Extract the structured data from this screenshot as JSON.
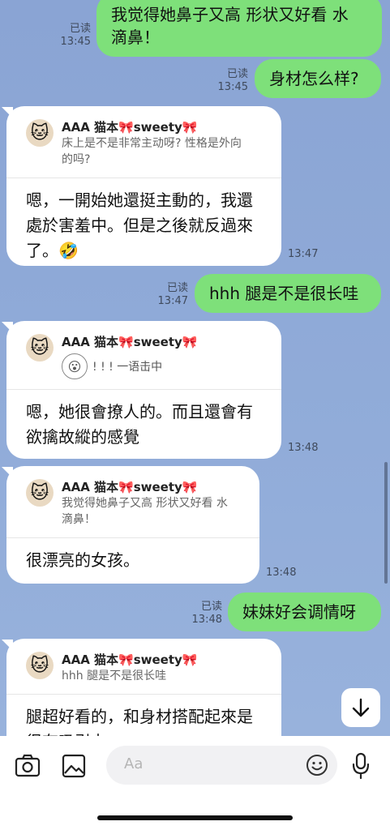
{
  "messages": {
    "m1": {
      "text_l1": "我觉得她鼻子又高 形状又好看 水",
      "text_l2": "滴鼻！",
      "status": "已读",
      "time": "13:45"
    },
    "m2": {
      "text": "身材怎么样?",
      "status": "已读",
      "time": "13:45"
    },
    "m3": {
      "reply_name": "AAA 猫本🎀sweety🎀",
      "reply_quote_l1": "床上是不是非常主动呀? 性格是外向",
      "reply_quote_l2": "的吗?",
      "text_l1": "嗯，一開始她還挺主動的，我還",
      "text_l2": "處於害羞中。但是之後就反過來",
      "text_l3": "了。🤣",
      "time": "13:47"
    },
    "m4": {
      "text": "hhh 腿是不是很长哇",
      "status": "已读",
      "time": "13:47"
    },
    "m5": {
      "reply_name": "AAA 猫本🎀sweety🎀",
      "reply_sticker_text": "! ! !  一语击中",
      "text_l1": "嗯，她很會撩人的。而且還會有",
      "text_l2": "欲擒故縱的感覺",
      "time": "13:48"
    },
    "m6": {
      "reply_name": "AAA 猫本🎀sweety🎀",
      "reply_quote_l1": "我觉得她鼻子又高 形状又好看 水",
      "reply_quote_l2": "滴鼻！",
      "text": "很漂亮的女孩。",
      "time": "13:48"
    },
    "m7": {
      "text": "妹妹好会调情呀",
      "status": "已读",
      "time": "13:48"
    },
    "m8": {
      "reply_name": "AAA 猫本🎀sweety🎀",
      "reply_quote_l1": "hhh 腿是不是很长哇",
      "text_l1": "腿超好看的，和身材搭配起來是",
      "text_l2": "很有吸引力"
    }
  },
  "input": {
    "placeholder": "Aa"
  },
  "colors": {
    "outgoing": "#7ee07a",
    "incoming": "#ffffff",
    "background": "#8ba6d6"
  },
  "icons": {
    "camera": "camera-icon",
    "image": "image-icon",
    "emoji": "emoji-icon",
    "mic": "microphone-icon",
    "down": "arrow-down-icon"
  }
}
